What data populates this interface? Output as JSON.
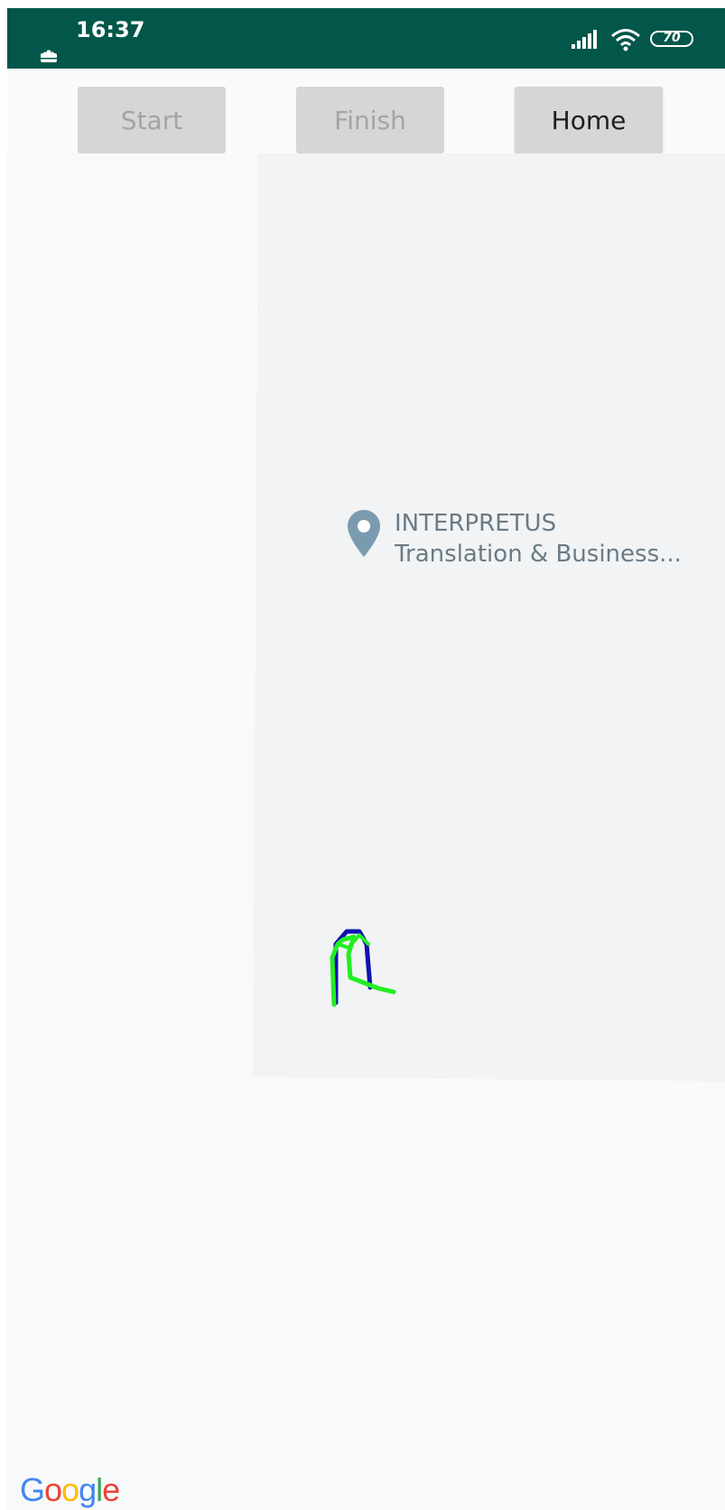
{
  "status_bar": {
    "time": "16:37",
    "battery": "70",
    "background_color": "#02574a",
    "icons": [
      "android-icon",
      "signal-icon",
      "wifi-icon",
      "battery-icon"
    ]
  },
  "toolbar": {
    "start_label": "Start",
    "finish_label": "Finish",
    "home_label": "Home"
  },
  "map": {
    "poi": {
      "name_line1": "INTERPRETUS",
      "name_line2": "Translation & Business...",
      "icon": "map-pin-icon"
    },
    "route_colors": {
      "planned": "#1010b0",
      "tracked": "#22ee22"
    },
    "logo": {
      "letters": [
        "G",
        "o",
        "o",
        "g",
        "l",
        "e"
      ]
    }
  }
}
